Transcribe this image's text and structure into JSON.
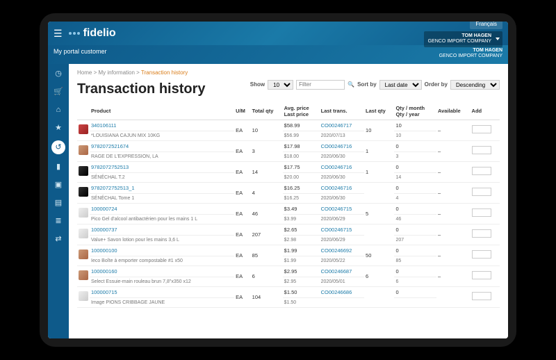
{
  "lang": "Français",
  "user": {
    "name": "TOM HAGEN",
    "company": "GENCO IMPORT COMPANY"
  },
  "brand": "fidelio",
  "portal": "My portal customer",
  "crumbs": {
    "home": "Home",
    "info": "My information",
    "page": "Transaction history"
  },
  "title": "Transaction history",
  "controls": {
    "show": "Show",
    "showVal": "10",
    "filter": "Filter",
    "sortby": "Sort by",
    "sortVal": "Last date",
    "orderby": "Order by",
    "orderVal": "Descending"
  },
  "cols": {
    "product": "Product",
    "um": "U/M",
    "totqty": "Total qty",
    "avgprice": "Avg. price",
    "lastprice": "Last price",
    "lasttrans": "Last trans.",
    "lastqty": "Last qty",
    "qtym": "Qty / month",
    "qtyy": "Qty / year",
    "avail": "Available",
    "add": "Add"
  },
  "rows": [
    {
      "th": "r",
      "sku": "340106111",
      "desc": "*LOUISIANA CAJUN MIX 10KG",
      "um": "EA",
      "tq": "10",
      "ap": "$58.99",
      "lp": "$56.99",
      "lt": "CO00246717",
      "ld": "2020/07/13",
      "lq": "10",
      "qm": "10",
      "qy": "10",
      "av": "–"
    },
    {
      "th": "",
      "sku": "9782072521674",
      "desc": "RAGE DE L'EXPRESSION, LA",
      "um": "EA",
      "tq": "3",
      "ap": "$17.98",
      "lp": "$18.00",
      "lt": "CO00246716",
      "ld": "2020/06/30",
      "lq": "1",
      "qm": "0",
      "qy": "3",
      "av": "–"
    },
    {
      "th": "d",
      "sku": "9782072752513",
      "desc": "SÉNÉCHAL T.2",
      "um": "EA",
      "tq": "14",
      "ap": "$17.75",
      "lp": "$20.00",
      "lt": "CO00246716",
      "ld": "2020/06/30",
      "lq": "1",
      "qm": "0",
      "qy": "14",
      "av": "–"
    },
    {
      "th": "d",
      "sku": "9782072752513_1",
      "desc": "SÉNÉCHAL Tome 1",
      "um": "EA",
      "tq": "4",
      "ap": "$16.25",
      "lp": "$16.25",
      "lt": "CO00246716",
      "ld": "2020/06/30",
      "lq": "",
      "qm": "0",
      "qy": "4",
      "av": "–"
    },
    {
      "th": "w",
      "sku": "100000724",
      "desc": "Pico Gel d'alcool antibactérien pour les mains 1 L",
      "um": "EA",
      "tq": "46",
      "ap": "$3.49",
      "lp": "$3.99",
      "lt": "CO00246715",
      "ld": "2020/06/29",
      "lq": "5",
      "qm": "0",
      "qy": "46",
      "av": "–"
    },
    {
      "th": "w",
      "sku": "100000737",
      "desc": "Value+ Savon lotion pour les mains 3,6 L",
      "um": "EA",
      "tq": "207",
      "ap": "$2.65",
      "lp": "$2.98",
      "lt": "CO00246715",
      "ld": "2020/06/29",
      "lq": "",
      "qm": "0",
      "qy": "207",
      "av": "–"
    },
    {
      "th": "",
      "sku": "100000100",
      "desc": "Ieco Boîte à emporter compostable #1 x50",
      "um": "EA",
      "tq": "85",
      "ap": "$1.99",
      "lp": "$1.99",
      "lt": "CO00246692",
      "ld": "2020/05/22",
      "lq": "50",
      "qm": "0",
      "qy": "85",
      "av": "–"
    },
    {
      "th": "",
      "sku": "100000160",
      "desc": "Select Essuie-main rouleau brun 7,8\"x350 x12",
      "um": "EA",
      "tq": "6",
      "ap": "$2.95",
      "lp": "$2.95",
      "lt": "CO00246687",
      "ld": "2020/05/01",
      "lq": "6",
      "qm": "0",
      "qy": "6",
      "av": "–"
    },
    {
      "th": "w",
      "sku": "100000715",
      "desc": "Image PIONS CRIBBAGE JAUNE",
      "um": "EA",
      "tq": "104",
      "ap": "$1.50",
      "lp": "$1.50",
      "lt": "CO00246686",
      "ld": "",
      "lq": "",
      "qm": "0",
      "qy": "",
      "av": ""
    }
  ]
}
